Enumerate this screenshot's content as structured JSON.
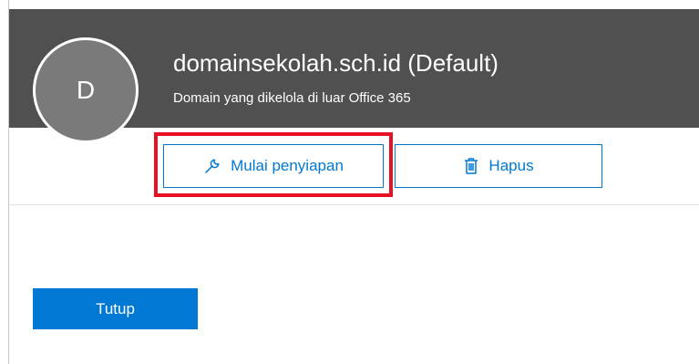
{
  "header": {
    "avatar_letter": "D",
    "title": "domainsekolah.sch.id (Default)",
    "subtitle": "Domain yang dikelola di luar Office 365"
  },
  "actions": {
    "setup": {
      "label": "Mulai penyiapan",
      "icon": "wrench-icon"
    },
    "delete": {
      "label": "Hapus",
      "icon": "trash-icon"
    }
  },
  "footer": {
    "close_label": "Tutup"
  },
  "colors": {
    "header_bg": "#505050",
    "accent": "#0078d4",
    "highlight": "#e81123"
  }
}
